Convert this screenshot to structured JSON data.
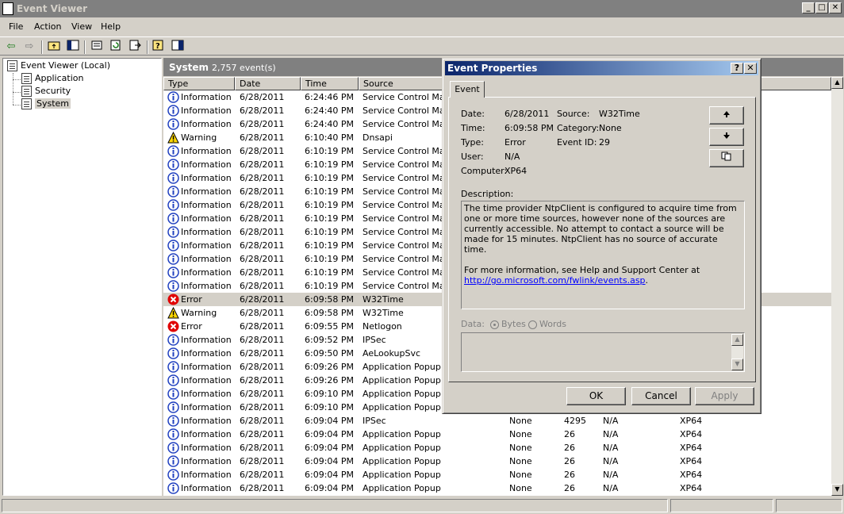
{
  "window": {
    "title": "Event Viewer"
  },
  "menu": [
    "File",
    "Action",
    "View",
    "Help"
  ],
  "tree": {
    "root": "Event Viewer (Local)",
    "items": [
      "Application",
      "Security",
      "System"
    ],
    "selected": "System"
  },
  "list_header": {
    "title": "System",
    "count": "2,757 event(s)"
  },
  "columns": [
    "Type",
    "Date",
    "Time",
    "Source"
  ],
  "rows": [
    {
      "type": "Information",
      "date": "6/28/2011",
      "time": "6:24:46 PM",
      "source": "Service Control Mana",
      "category": "",
      "event": "",
      "user": "",
      "computer": ""
    },
    {
      "type": "Information",
      "date": "6/28/2011",
      "time": "6:24:40 PM",
      "source": "Service Control Mana",
      "category": "",
      "event": "",
      "user": "",
      "computer": ""
    },
    {
      "type": "Information",
      "date": "6/28/2011",
      "time": "6:24:40 PM",
      "source": "Service Control Mana",
      "category": "",
      "event": "",
      "user": "",
      "computer": ""
    },
    {
      "type": "Warning",
      "date": "6/28/2011",
      "time": "6:10:40 PM",
      "source": "Dnsapi",
      "category": "",
      "event": "",
      "user": "",
      "computer": ""
    },
    {
      "type": "Information",
      "date": "6/28/2011",
      "time": "6:10:19 PM",
      "source": "Service Control Mana",
      "category": "",
      "event": "",
      "user": "",
      "computer": ""
    },
    {
      "type": "Information",
      "date": "6/28/2011",
      "time": "6:10:19 PM",
      "source": "Service Control Mana",
      "category": "",
      "event": "",
      "user": "",
      "computer": ""
    },
    {
      "type": "Information",
      "date": "6/28/2011",
      "time": "6:10:19 PM",
      "source": "Service Control Mana",
      "category": "",
      "event": "",
      "user": "",
      "computer": ""
    },
    {
      "type": "Information",
      "date": "6/28/2011",
      "time": "6:10:19 PM",
      "source": "Service Control Mana",
      "category": "",
      "event": "",
      "user": "",
      "computer": ""
    },
    {
      "type": "Information",
      "date": "6/28/2011",
      "time": "6:10:19 PM",
      "source": "Service Control Mana",
      "category": "",
      "event": "",
      "user": "",
      "computer": ""
    },
    {
      "type": "Information",
      "date": "6/28/2011",
      "time": "6:10:19 PM",
      "source": "Service Control Mana",
      "category": "",
      "event": "",
      "user": "",
      "computer": ""
    },
    {
      "type": "Information",
      "date": "6/28/2011",
      "time": "6:10:19 PM",
      "source": "Service Control Mana",
      "category": "",
      "event": "",
      "user": "",
      "computer": ""
    },
    {
      "type": "Information",
      "date": "6/28/2011",
      "time": "6:10:19 PM",
      "source": "Service Control Mana",
      "category": "",
      "event": "",
      "user": "",
      "computer": ""
    },
    {
      "type": "Information",
      "date": "6/28/2011",
      "time": "6:10:19 PM",
      "source": "Service Control Mana",
      "category": "",
      "event": "",
      "user": "",
      "computer": ""
    },
    {
      "type": "Information",
      "date": "6/28/2011",
      "time": "6:10:19 PM",
      "source": "Service Control Mana",
      "category": "",
      "event": "",
      "user": "",
      "computer": ""
    },
    {
      "type": "Information",
      "date": "6/28/2011",
      "time": "6:10:19 PM",
      "source": "Service Control Mana",
      "category": "",
      "event": "",
      "user": "",
      "computer": ""
    },
    {
      "type": "Error",
      "date": "6/28/2011",
      "time": "6:09:58 PM",
      "source": "W32Time",
      "category": "",
      "event": "",
      "user": "",
      "computer": "",
      "selected": true
    },
    {
      "type": "Warning",
      "date": "6/28/2011",
      "time": "6:09:58 PM",
      "source": "W32Time",
      "category": "",
      "event": "",
      "user": "",
      "computer": ""
    },
    {
      "type": "Error",
      "date": "6/28/2011",
      "time": "6:09:55 PM",
      "source": "Netlogon",
      "category": "",
      "event": "",
      "user": "",
      "computer": ""
    },
    {
      "type": "Information",
      "date": "6/28/2011",
      "time": "6:09:52 PM",
      "source": "IPSec",
      "category": "",
      "event": "",
      "user": "",
      "computer": ""
    },
    {
      "type": "Information",
      "date": "6/28/2011",
      "time": "6:09:50 PM",
      "source": "AeLookupSvc",
      "category": "",
      "event": "",
      "user": "",
      "computer": ""
    },
    {
      "type": "Information",
      "date": "6/28/2011",
      "time": "6:09:26 PM",
      "source": "Application Popup",
      "category": "",
      "event": "",
      "user": "",
      "computer": ""
    },
    {
      "type": "Information",
      "date": "6/28/2011",
      "time": "6:09:26 PM",
      "source": "Application Popup",
      "category": "",
      "event": "",
      "user": "",
      "computer": ""
    },
    {
      "type": "Information",
      "date": "6/28/2011",
      "time": "6:09:10 PM",
      "source": "Application Popup",
      "category": "",
      "event": "",
      "user": "",
      "computer": ""
    },
    {
      "type": "Information",
      "date": "6/28/2011",
      "time": "6:09:10 PM",
      "source": "Application Popup",
      "category": "",
      "event": "",
      "user": "",
      "computer": ""
    },
    {
      "type": "Information",
      "date": "6/28/2011",
      "time": "6:09:04 PM",
      "source": "IPSec",
      "category": "None",
      "event": "4295",
      "user": "N/A",
      "computer": "XP64"
    },
    {
      "type": "Information",
      "date": "6/28/2011",
      "time": "6:09:04 PM",
      "source": "Application Popup",
      "category": "None",
      "event": "26",
      "user": "N/A",
      "computer": "XP64"
    },
    {
      "type": "Information",
      "date": "6/28/2011",
      "time": "6:09:04 PM",
      "source": "Application Popup",
      "category": "None",
      "event": "26",
      "user": "N/A",
      "computer": "XP64"
    },
    {
      "type": "Information",
      "date": "6/28/2011",
      "time": "6:09:04 PM",
      "source": "Application Popup",
      "category": "None",
      "event": "26",
      "user": "N/A",
      "computer": "XP64"
    },
    {
      "type": "Information",
      "date": "6/28/2011",
      "time": "6:09:04 PM",
      "source": "Application Popup",
      "category": "None",
      "event": "26",
      "user": "N/A",
      "computer": "XP64"
    },
    {
      "type": "Information",
      "date": "6/28/2011",
      "time": "6:09:04 PM",
      "source": "Application Popup",
      "category": "None",
      "event": "26",
      "user": "N/A",
      "computer": "XP64"
    }
  ],
  "dialog": {
    "title": "Event Properties",
    "help_btn": "?",
    "close_btn": "✕",
    "tab": "Event",
    "fields": {
      "date_label": "Date:",
      "date": "6/28/2011",
      "time_label": "Time:",
      "time": "6:09:58 PM",
      "type_label": "Type:",
      "type": "Error",
      "user_label": "User:",
      "user": "N/A",
      "computer_label": "Computer:",
      "computer": "XP64",
      "source_label": "Source:",
      "source": "W32Time",
      "category_label": "Category:",
      "category": "None",
      "eventid_label": "Event ID:",
      "eventid": "29"
    },
    "description_label": "Description:",
    "description": "The time provider NtpClient is configured to acquire time from one or more time sources, however none of the sources are currently accessible.  No attempt to contact a source will be made for 15 minutes. NtpClient has no source of accurate time.",
    "more_info": "For more information, see Help and Support Center at",
    "link": "http://go.microsoft.com/fwlink/events.asp",
    "link_suffix": ".",
    "data_label": "Data:",
    "bytes_label": "Bytes",
    "words_label": "Words",
    "ok": "OK",
    "cancel": "Cancel",
    "apply": "Apply"
  },
  "colors": {
    "error": "#e00000",
    "warning": "#ffd800",
    "info": "#1f3fbf",
    "title_active": "#0a246a"
  }
}
